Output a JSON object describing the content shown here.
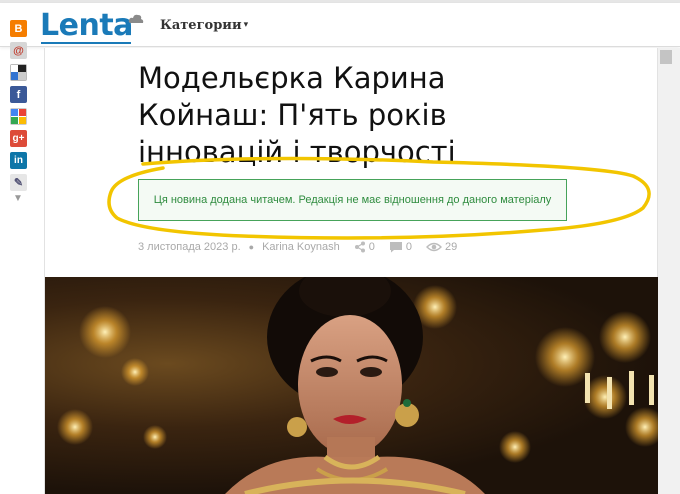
{
  "header": {
    "logo": "Lenta",
    "categories_label": "Категории"
  },
  "article": {
    "title": "Модельєрка Карина Койнаш: П'ять років інновацій і творчості",
    "notice": "Ця новина додана читачем. Редакція не має відношення до даного матеріалу",
    "date": "3 листопада 2023 р.",
    "author": "Karina Koynash",
    "shares": "0",
    "comments": "0",
    "views": "29"
  },
  "social": {
    "icons": [
      "blogger-icon",
      "myworld-icon",
      "delicious-icon",
      "facebook-icon",
      "google-bookmarks-icon",
      "google-plus-icon",
      "linkedin-icon",
      "bookmark-icon"
    ]
  },
  "colors": {
    "brand": "#1a7ab8",
    "notice_border": "#46a35a",
    "notice_text": "#2f8c3f",
    "annotation": "#f2c500"
  }
}
